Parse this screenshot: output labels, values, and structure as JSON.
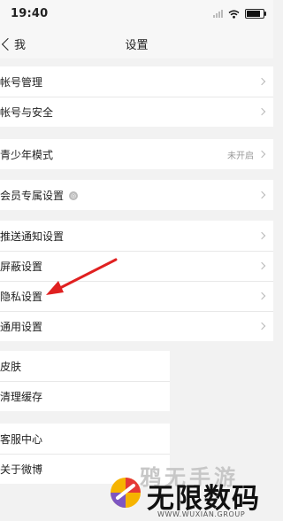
{
  "status_bar": {
    "time": "19:40"
  },
  "nav": {
    "back_label": "我",
    "title": "设置"
  },
  "groups": [
    {
      "items": [
        {
          "label": "帐号管理"
        },
        {
          "label": "帐号与安全"
        }
      ]
    },
    {
      "items": [
        {
          "label": "青少年模式",
          "value": "未开启"
        }
      ]
    },
    {
      "items": [
        {
          "label": "会员专属设置"
        }
      ]
    },
    {
      "items": [
        {
          "label": "推送通知设置"
        },
        {
          "label": "屏蔽设置"
        },
        {
          "label": "隐私设置"
        },
        {
          "label": "通用设置"
        }
      ]
    },
    {
      "items": [
        {
          "label": "皮肤"
        },
        {
          "label": "清理缓存"
        }
      ]
    },
    {
      "items": [
        {
          "label": "客服中心"
        },
        {
          "label": "关于微博"
        }
      ]
    }
  ],
  "watermark": {
    "top": "鸦无手游",
    "main": "无限数码",
    "sub": "WWW.WUXIAN.GROUP"
  },
  "colors": {
    "arrow": "#e02020",
    "background": "#f2f2f2"
  }
}
